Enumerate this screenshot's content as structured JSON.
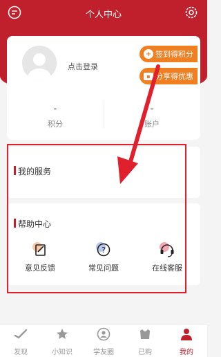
{
  "header": {
    "title": "个人中心"
  },
  "profile": {
    "login_label": "点击登录",
    "points_value": "-",
    "points_label": "积分",
    "account_value": "-",
    "account_label": "账户"
  },
  "promos": [
    {
      "label": "签到得积分",
      "icon": "plus-circle-icon"
    },
    {
      "label": "分享得优惠",
      "icon": "ticket-icon"
    }
  ],
  "services": {
    "title": "我的服务"
  },
  "help": {
    "title": "帮助中心",
    "items": [
      {
        "label": "意见反馈",
        "icon": "feedback-edit-icon"
      },
      {
        "label": "常见问题",
        "icon": "question-icon"
      },
      {
        "label": "在线客服",
        "icon": "headset-icon"
      }
    ]
  },
  "tabbar": {
    "items": [
      {
        "label": "发现",
        "icon": "check-icon"
      },
      {
        "label": "小知识",
        "icon": "star-icon"
      },
      {
        "label": "学友圈",
        "icon": "group-icon"
      },
      {
        "label": "已购",
        "icon": "bag-icon"
      },
      {
        "label": "我的",
        "icon": "person-icon",
        "active": true
      }
    ]
  },
  "colors": {
    "brand": "#c0202c",
    "promo": "#f07f22",
    "annotation": "#e0202c"
  }
}
